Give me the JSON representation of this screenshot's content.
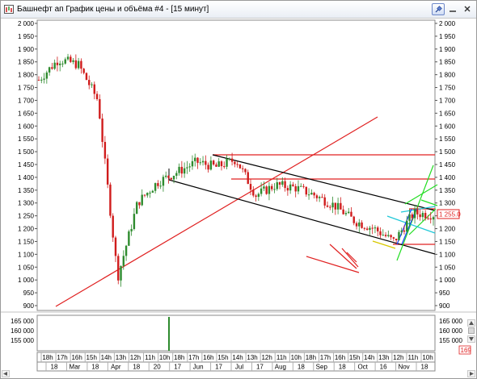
{
  "window": {
    "title": "Башнефт ап График цены и объёма #4 - [15 минут]"
  },
  "price_axis": {
    "ticks": [
      "2 000",
      "1 950",
      "1 900",
      "1 850",
      "1 800",
      "1 750",
      "1 700",
      "1 650",
      "1 600",
      "1 550",
      "1 500",
      "1 450",
      "1 400",
      "1 350",
      "1 300",
      "1 250",
      "1 200",
      "1 150",
      "1 100",
      "1 050",
      "1 000",
      "950",
      "900"
    ],
    "min": 900,
    "max": 2000,
    "last_price": "1 255.0"
  },
  "volume_axis": {
    "ticks": [
      "165 000",
      "160 000",
      "155 000"
    ],
    "current_value": "169"
  },
  "time_axis": {
    "hour_labels": [
      "18h",
      "17h",
      "16h",
      "15h",
      "14h",
      "13h",
      "12h",
      "11h",
      "10h",
      "18h",
      "17h",
      "16h",
      "15h",
      "14h",
      "13h",
      "12h",
      "11h",
      "10h",
      "18h",
      "17h",
      "16h",
      "15h",
      "14h",
      "13h",
      "12h",
      "11h",
      "10h"
    ],
    "date_labels": [
      "18",
      "Mar",
      "18",
      "Apr",
      "18",
      "20",
      "17",
      "Jun",
      "17",
      "Jul",
      "17",
      "Aug",
      "18",
      "Sep",
      "18",
      "Oct",
      "16",
      "Nov",
      "18"
    ]
  },
  "chart_data": {
    "type": "candlestick",
    "price_range": [
      900,
      2000
    ],
    "volume_range": [
      150000,
      170000
    ],
    "approximate_close_path": [
      {
        "x": "18h",
        "price": 1780
      },
      {
        "x": "18h",
        "price": 1860
      },
      {
        "x": "17h",
        "price": 1840
      },
      {
        "x": "17h",
        "price": 1700
      },
      {
        "x": "16h",
        "price": 1010
      },
      {
        "x": "16h",
        "price": 1300
      },
      {
        "x": "15h",
        "price": 1380
      },
      {
        "x": "14h",
        "price": 1420
      },
      {
        "x": "13h",
        "price": 1460
      },
      {
        "x": "12h",
        "price": 1440
      },
      {
        "x": "11h",
        "price": 1470
      },
      {
        "x": "10h",
        "price": 1330
      },
      {
        "x": "18h",
        "price": 1370
      },
      {
        "x": "17h",
        "price": 1360
      },
      {
        "x": "16h",
        "price": 1330
      },
      {
        "x": "15h",
        "price": 1290
      },
      {
        "x": "14h",
        "price": 1230
      },
      {
        "x": "13h",
        "price": 1200
      },
      {
        "x": "12h",
        "price": 1150
      },
      {
        "x": "11h",
        "price": 1260
      },
      {
        "x": "10h",
        "price": 1255
      }
    ],
    "drawn_levels": [
      1485,
      1390,
      1275,
      1140
    ],
    "colors": {
      "up": "#2e8b2e",
      "down": "#d01c1c",
      "channel": "#000000",
      "trendline": "#e02020",
      "label_bg": "#ffffff",
      "label_border": "#e02020"
    }
  }
}
